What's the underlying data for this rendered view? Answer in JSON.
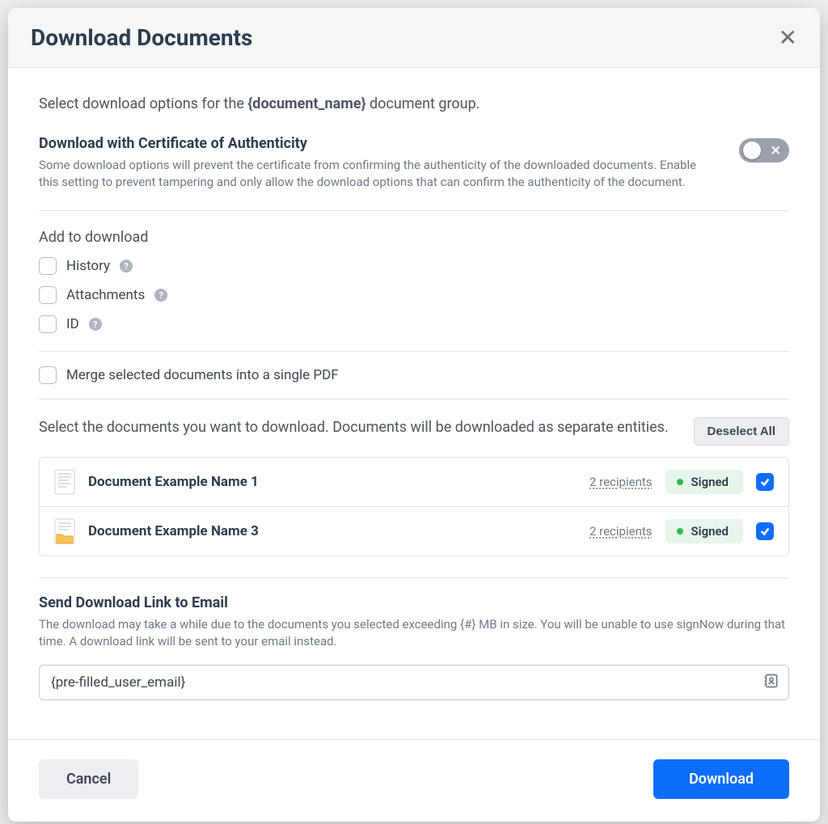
{
  "header": {
    "title": "Download Documents"
  },
  "intro": {
    "prefix": "Select download options for the ",
    "document_name": "{document_name}",
    "suffix": " document group."
  },
  "certificate": {
    "title": "Download with Certificate of Authenticity",
    "description": "Some download options will prevent the certificate from confirming the authenticity of the downloaded documents. Enable this setting to prevent tampering and only allow the download options that can confirm the authenticity of the document.",
    "enabled": false
  },
  "add_to_download": {
    "label": "Add to download",
    "items": [
      {
        "label": "History"
      },
      {
        "label": "Attachments"
      },
      {
        "label": "ID"
      }
    ]
  },
  "merge": {
    "label": "Merge selected documents into a single PDF"
  },
  "docs": {
    "instruction": "Select the documents you want to download. Documents will be downloaded as separate entities.",
    "deselect_label": "Deselect All",
    "rows": [
      {
        "name": "Document Example Name 1",
        "recipients": "2 recipients",
        "status": "Signed",
        "thumb": "page"
      },
      {
        "name": "Document Example Name 3",
        "recipients": "2 recipients",
        "status": "Signed",
        "thumb": "folder"
      }
    ]
  },
  "email": {
    "title": "Send Download Link to Email",
    "description": "The download may take a while due to the documents you selected exceeding {#} MB in size. You will be unable to use signNow during that time. A download link will be sent to your email instead.",
    "value": "{pre-filled_user_email}"
  },
  "footer": {
    "cancel": "Cancel",
    "download": "Download"
  }
}
